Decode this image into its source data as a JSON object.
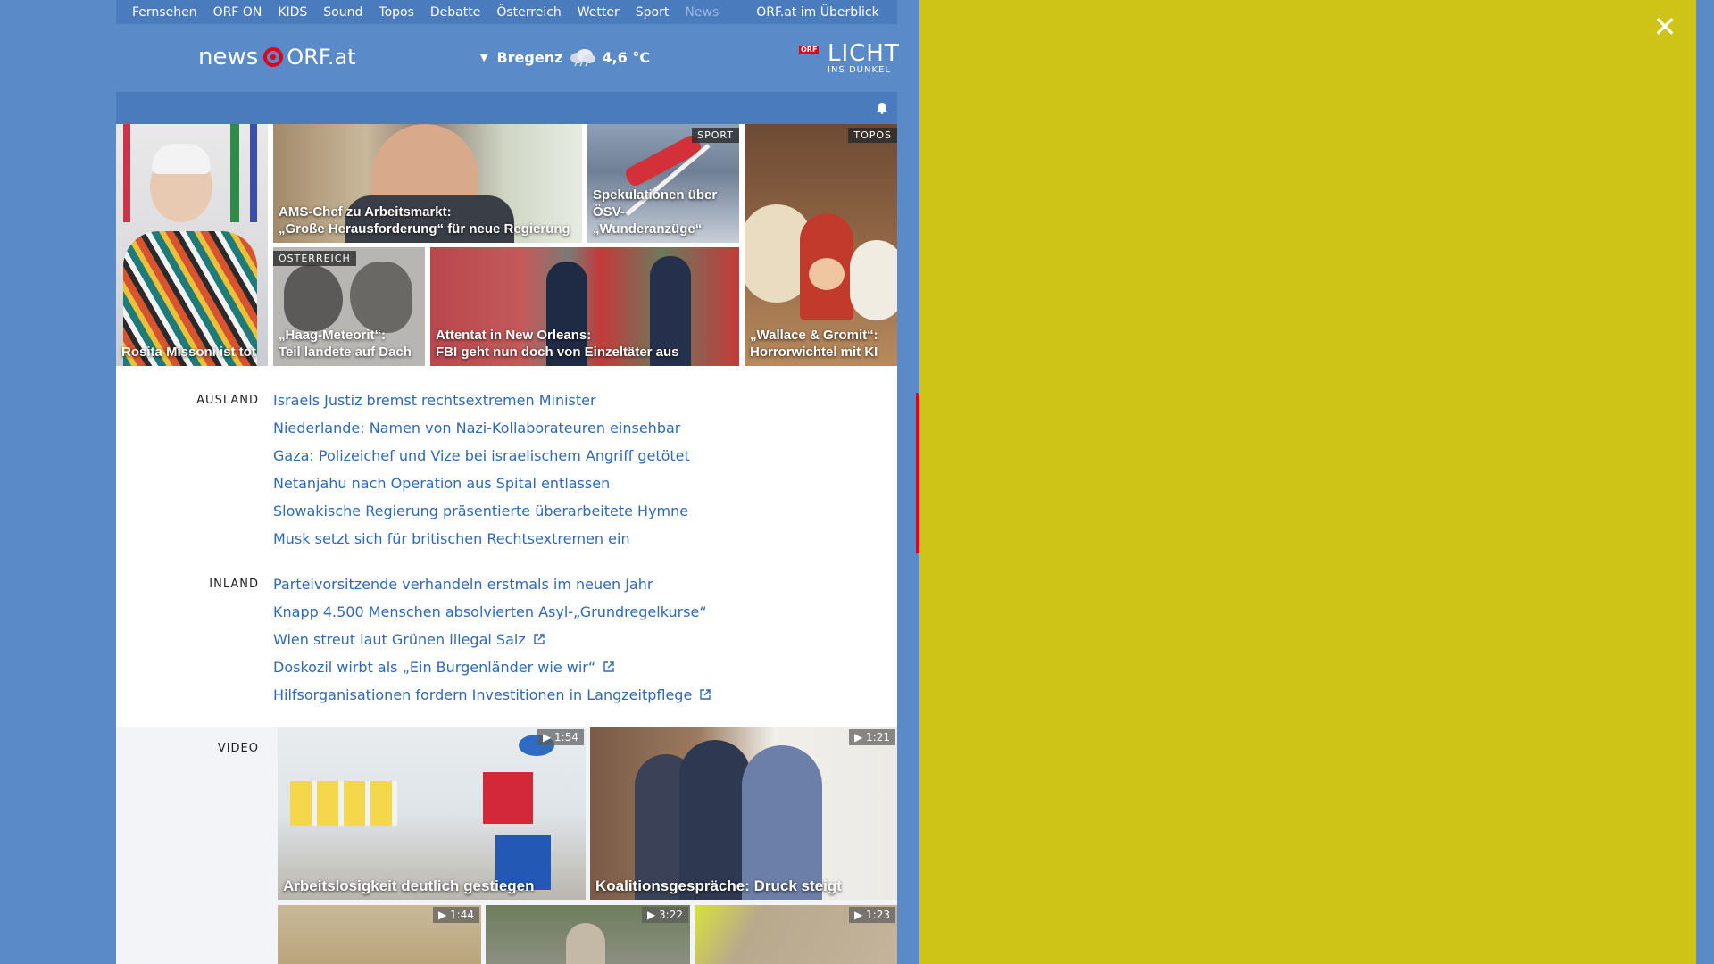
{
  "nav": {
    "items": [
      "Fernsehen",
      "ORF ON",
      "KIDS",
      "Sound",
      "Topos",
      "Debatte",
      "Österreich",
      "Wetter",
      "Sport",
      "News"
    ],
    "active": "News",
    "overview": "ORF.at im Überblick"
  },
  "header": {
    "logo_news": "news",
    "logo_orf": "ORF.at",
    "weather_location": "Bregenz",
    "weather_temp": "4,6 °C",
    "weather_icon": "cloud-rain-icon",
    "licht_badge": "ORF",
    "licht_title": "LICHT",
    "licht_sub": "INS DUNKEL"
  },
  "tiles": {
    "t1": {
      "caption": "Rosita Missoni ist tot"
    },
    "t2": {
      "caption_line1": "AMS-Chef zu Arbeitsmarkt:",
      "caption_line2": "„Große Herausforderung“ für neue Regierung"
    },
    "t3": {
      "tag": "SPORT",
      "caption_line1": "Spekulationen über",
      "caption_line2": "ÖSV-„Wunderanzüge“"
    },
    "t4": {
      "tag": "TOPOS",
      "caption_line1": "„Wallace & Gromit“:",
      "caption_line2": "Horrorwichtel mit KI"
    },
    "t5": {
      "tag": "ÖSTERREICH",
      "caption_line1": "„Haag-Meteorit“:",
      "caption_line2": "Teil landete auf Dach"
    },
    "t6": {
      "caption_line1": "Attentat in New Orleans:",
      "caption_line2": "FBI geht nun doch von Einzeltäter aus"
    }
  },
  "ausland": {
    "label": "AUSLAND",
    "links": [
      "Israels Justiz bremst rechtsextremen Minister",
      "Niederlande: Namen von Nazi-Kollaborateuren einsehbar",
      "Gaza: Polizeichef und Vize bei israelischem Angriff getötet",
      "Netanjahu nach Operation aus Spital entlassen",
      "Slowakische Regierung präsentierte überarbeitete Hymne",
      "Musk setzt sich für britischen Rechtsextremen ein"
    ]
  },
  "inland": {
    "label": "INLAND",
    "links": [
      "Parteivorsitzende verhandeln erstmals im neuen Jahr",
      "Knapp 4.500 Menschen absolvierten Asyl-„Grundregelkurse“",
      "Wien streut laut Grünen illegal Salz",
      "Doskozil wirbt als „Ein Burgenländer wie wir“",
      "Hilfsorganisationen fordern Investitionen in Langzeitpflege"
    ]
  },
  "video": {
    "label": "VIDEO",
    "v1": {
      "duration": "1:54",
      "caption": "Arbeitslosigkeit deutlich gestiegen"
    },
    "v2": {
      "duration": "1:21",
      "caption": "Koalitionsgespräche: Druck steigt"
    },
    "v3": {
      "duration": "1:44"
    },
    "v4": {
      "duration": "3:22"
    },
    "v5": {
      "duration": "1:23"
    }
  },
  "overlay": {
    "close_symbol": "✕"
  },
  "colors": {
    "page_bg": "#5b8ac9",
    "link": "#2f69b5",
    "panel": "#cdc417",
    "orf_red": "#e0001b"
  }
}
